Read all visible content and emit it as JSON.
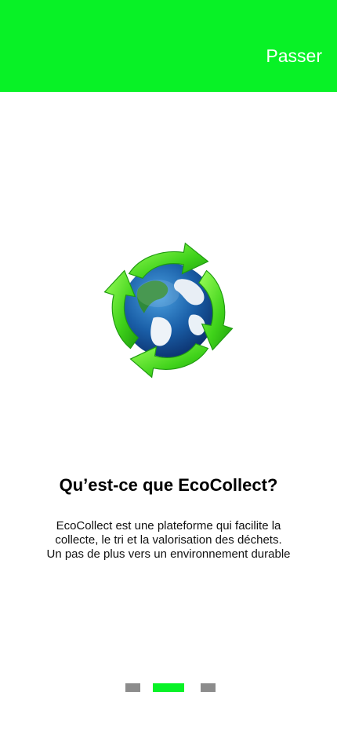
{
  "header": {
    "skip_label": "Passer",
    "accent_color": "#08f226"
  },
  "onboarding": {
    "illustration_icon": "recycle-globe-icon",
    "title": "Qu’est-ce que EcoCollect?",
    "description_line1": "EcoCollect est une plateforme qui facilite la",
    "description_line2": "collecte, le tri et la valorisation des déchets.",
    "description_line3": "Un pas de plus vers un environnement durable"
  },
  "pagination": {
    "active_index": 1,
    "count": 3,
    "active_color": "#08f226",
    "inactive_color": "#8c8c8c"
  }
}
